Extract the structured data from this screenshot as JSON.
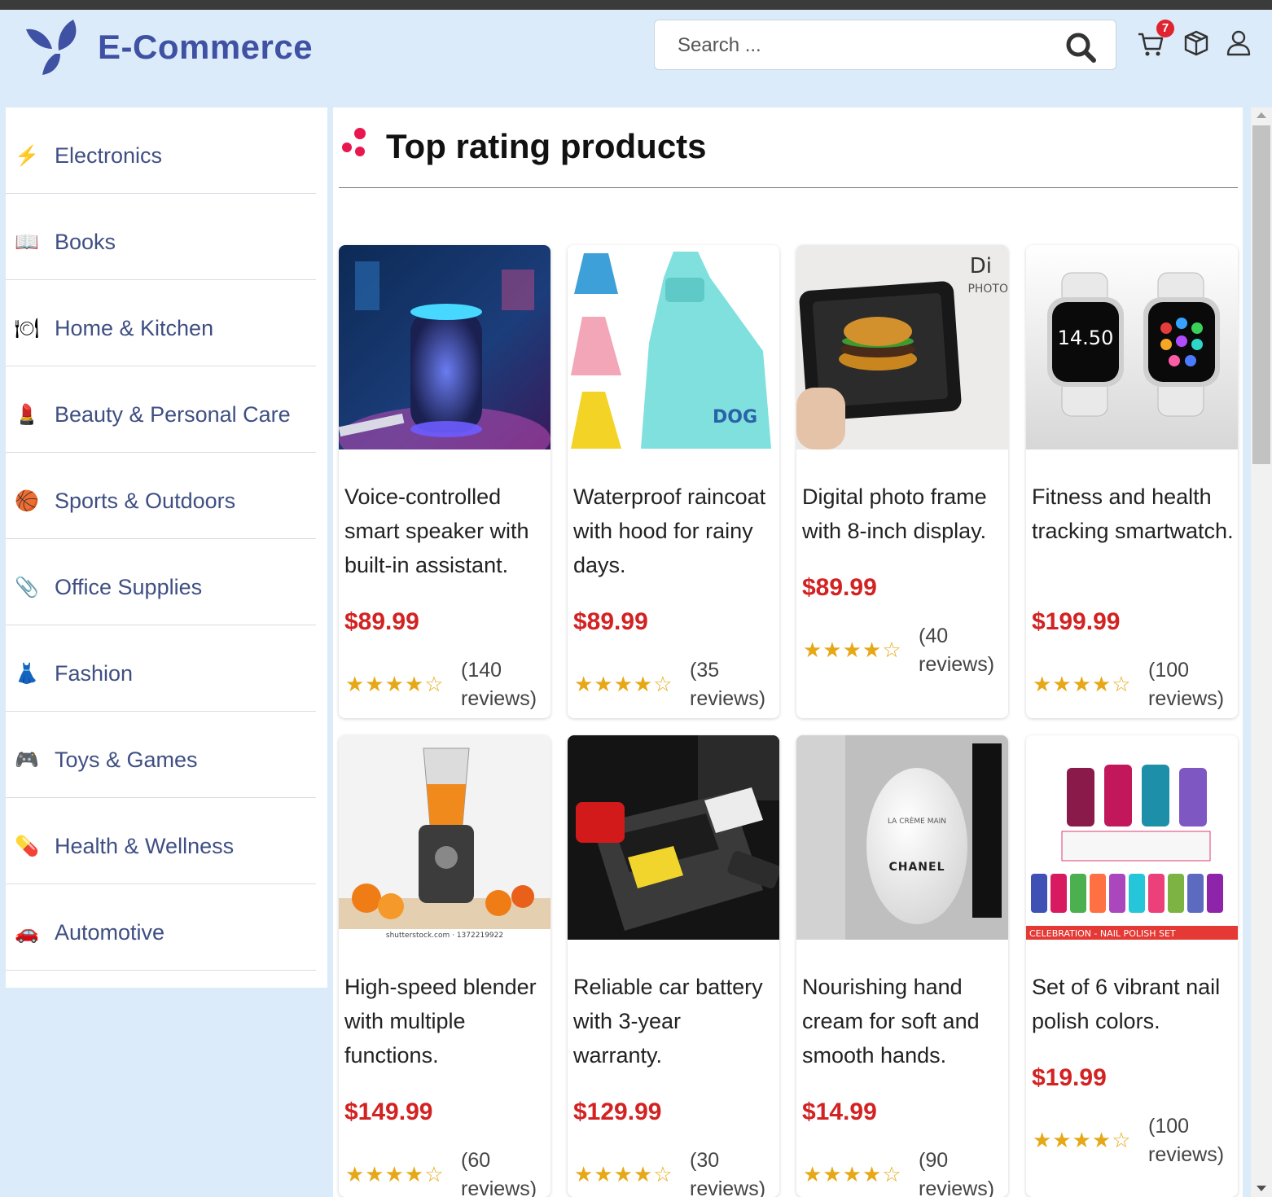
{
  "header": {
    "brand": "E-Commerce",
    "search_placeholder": "Search ...",
    "cart_count": "7",
    "icons": [
      "logo-icon",
      "search-icon",
      "cart-icon",
      "box-icon",
      "user-icon"
    ]
  },
  "sidebar": {
    "items": [
      {
        "label": "Electronics",
        "icon": "lightning-icon",
        "glyph": "⚡"
      },
      {
        "label": "Books",
        "icon": "book-icon",
        "glyph": "📖"
      },
      {
        "label": "Home & Kitchen",
        "icon": "plate-icon",
        "glyph": "🍽"
      },
      {
        "label": "Beauty & Personal Care",
        "icon": "lipstick-icon",
        "glyph": "💄"
      },
      {
        "label": "Sports & Outdoors",
        "icon": "basketball-icon",
        "glyph": "🏀"
      },
      {
        "label": "Office Supplies",
        "icon": "paperclip-icon",
        "glyph": "📎"
      },
      {
        "label": "Fashion",
        "icon": "dress-icon",
        "glyph": "👗"
      },
      {
        "label": "Toys & Games",
        "icon": "gamepad-icon",
        "glyph": "🎮"
      },
      {
        "label": "Health & Wellness",
        "icon": "pill-icon",
        "glyph": "💊"
      },
      {
        "label": "Automotive",
        "icon": "car-icon",
        "glyph": "🚗"
      }
    ]
  },
  "main": {
    "title": "Top rating products",
    "products": [
      {
        "desc": "Voice-controlled smart speaker with built-in assistant.",
        "price": "$89.99",
        "stars": "★★★★☆",
        "reviews": "(140 reviews)",
        "rating": 4.5,
        "image": "smart-speaker"
      },
      {
        "desc": "Waterproof raincoat with hood for rainy days.",
        "price": "$89.99",
        "stars": "★★★★☆",
        "reviews": "(35 reviews)",
        "rating": 4.5,
        "image": "raincoat"
      },
      {
        "desc": "Digital photo frame with 8-inch display.",
        "price": "$89.99",
        "stars": "★★★★☆",
        "reviews": "(40 reviews)",
        "rating": 4.5,
        "image": "photo-frame"
      },
      {
        "desc": "Fitness and health tracking smartwatch.",
        "price": "$199.99",
        "stars": "★★★★☆",
        "reviews": "(100 reviews)",
        "rating": 4.5,
        "image": "smartwatch"
      },
      {
        "desc": "High-speed blender with multiple functions.",
        "price": "$149.99",
        "stars": "★★★★☆",
        "reviews": "(60 reviews)",
        "rating": 4.5,
        "image": "blender"
      },
      {
        "desc": "Reliable car battery with 3-year warranty.",
        "price": "$129.99",
        "stars": "★★★★☆",
        "reviews": "(30 reviews)",
        "rating": 4.5,
        "image": "car-battery"
      },
      {
        "desc": "Nourishing hand cream for soft and smooth hands.",
        "price": "$14.99",
        "stars": "★★★★☆",
        "reviews": "(90 reviews)",
        "rating": 4.5,
        "image": "hand-cream"
      },
      {
        "desc": "Set of 6 vibrant nail polish colors.",
        "price": "$19.99",
        "stars": "★★★★☆",
        "reviews": "(100 reviews)",
        "rating": 4.5,
        "image": "nail-polish"
      }
    ],
    "image_text": {
      "watch_time": "14.50",
      "frame_sign": "Di",
      "frame_sign2": "PHOTO",
      "blender_credit": "shutterstock.com · 1372219922",
      "cream_brand": "CHANEL",
      "cream_sub": "LA CRÈME MAIN",
      "nail_banner": "CELEBRATION - NAIL POLISH SET",
      "raincoat_text": "DOG"
    }
  },
  "colors": {
    "brand": "#3f51a3",
    "price": "#d32222",
    "star": "#e6a817",
    "badge": "#e0242f",
    "header_bg": "#dcebf9"
  }
}
